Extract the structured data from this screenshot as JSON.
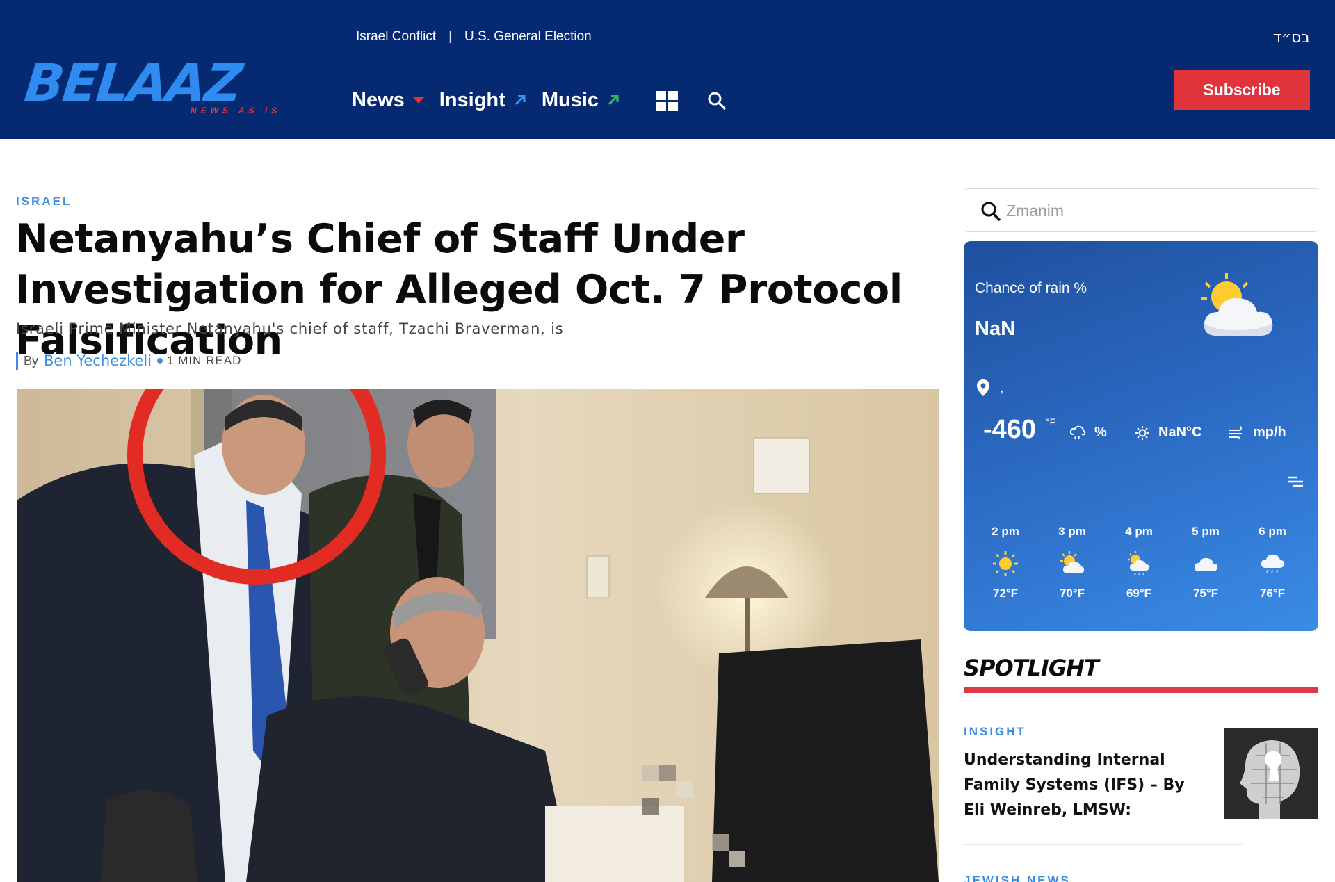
{
  "header": {
    "logo_text": "BELAAZ",
    "logo_tagline": "NEWS AS IS",
    "top_links": [
      "Israel Conflict",
      "U.S. General Election"
    ],
    "top_separator": "|",
    "hebrew": "בס״ד",
    "subscribe_label": "Subscribe",
    "nav": [
      {
        "label": "News",
        "icon": "caret-down-icon",
        "icon_color": "#e0333c"
      },
      {
        "label": "Insight",
        "icon": "arrow-up-right-icon",
        "icon_color": "#3b8ee6"
      },
      {
        "label": "Music",
        "icon": "arrow-up-right-icon",
        "icon_color": "#2fb36b"
      }
    ],
    "bg_color": "#052a72"
  },
  "article": {
    "category": "ISRAEL",
    "title": "Netanyahu’s Chief of Staff Under Investigation for Alleged Oct. 7 Protocol Falsification",
    "excerpt": "Israeli Prime Minister Netanyahu's chief of staff, Tzachi Braverman, is",
    "byline_prefix": "By",
    "author": "Ben Yechezkeli",
    "read_time": "1 MIN READ",
    "accent_color": "#3b8ee6"
  },
  "sidebar": {
    "search": {
      "placeholder": "Zmanim"
    },
    "weather": {
      "rain_label": "Chance of rain %",
      "rain_value": "NaN",
      "location": ",",
      "temp": "-460",
      "temp_unit": "°F",
      "humidity": "%",
      "feels": "NaN°C",
      "wind": "mp/h",
      "hours": [
        {
          "time": "2 pm",
          "temp": "72°F",
          "icon": "sun-icon"
        },
        {
          "time": "3 pm",
          "temp": "70°F",
          "icon": "partly-cloudy-icon"
        },
        {
          "time": "4 pm",
          "temp": "69°F",
          "icon": "cloud-sun-rain-icon"
        },
        {
          "time": "5 pm",
          "temp": "75°F",
          "icon": "cloud-icon"
        },
        {
          "time": "6 pm",
          "temp": "76°F",
          "icon": "cloud-rain-icon"
        }
      ]
    },
    "spotlight": {
      "title": "SPOTLIGHT",
      "bar_color": "#d93a45",
      "items": [
        {
          "category": "INSIGHT",
          "headline": "Understanding Internal Family Systems (IFS) – By Eli Weinreb, LMSW:"
        },
        {
          "category": "JEWISH NEWS"
        }
      ]
    }
  }
}
